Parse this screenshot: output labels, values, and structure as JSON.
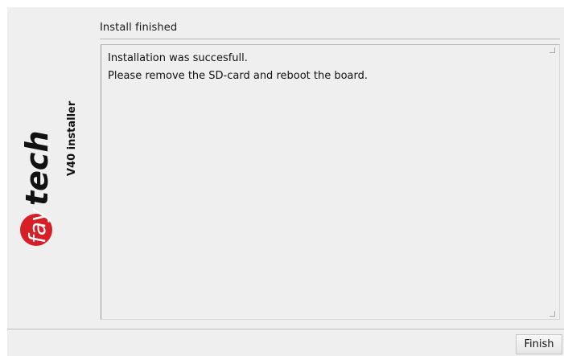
{
  "logo": {
    "prefix": "fay",
    "suffix": "tech",
    "product": "V40 installer"
  },
  "content": {
    "title": "Install finished",
    "message_lines": [
      "Installation was succesfull.",
      "Please remove the SD-card and reboot the board."
    ]
  },
  "buttons": {
    "finish_label": "Finish"
  },
  "colors": {
    "brand_red": "#d61f26",
    "logo_black": "#111111",
    "window_bg": "#efefef"
  }
}
